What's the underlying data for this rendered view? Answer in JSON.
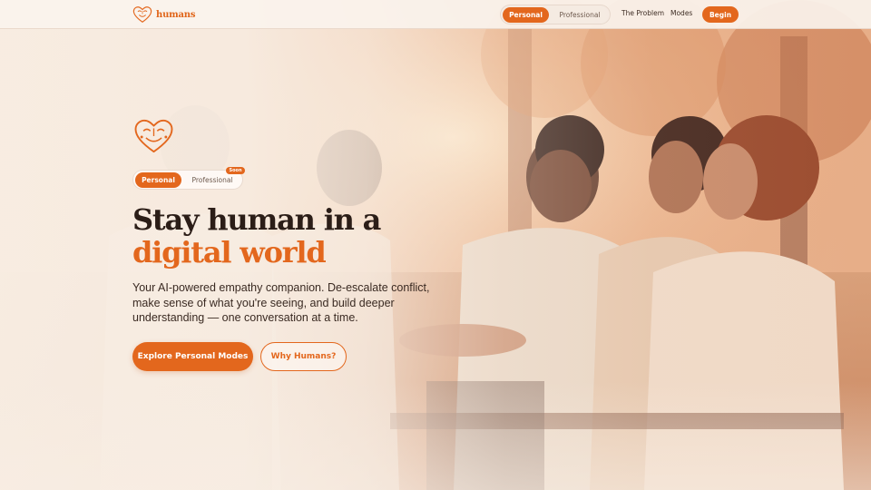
{
  "brand": {
    "name": "humans",
    "logo_icon": "heart-face-icon"
  },
  "nav": {
    "toggle": {
      "active": "Personal",
      "inactive": "Professional"
    },
    "links": [
      "The Problem",
      "Modes"
    ],
    "cta": "Begin"
  },
  "hero": {
    "icon": "heart-face-icon",
    "toggle": {
      "active": "Personal",
      "inactive": "Professional",
      "badge": "Soon"
    },
    "headline_line1": "Stay human in a",
    "headline_line2": "digital world",
    "subtext": "Your AI-powered empathy companion. De-escalate conflict, make sense of what you're seeing, and build deeper understanding — one conversation at a time.",
    "primary_cta": "Explore Personal Modes",
    "secondary_cta": "Why Humans?"
  },
  "colors": {
    "accent": "#e3671d",
    "heading": "#2b1d17",
    "background": "#f8eee4"
  }
}
